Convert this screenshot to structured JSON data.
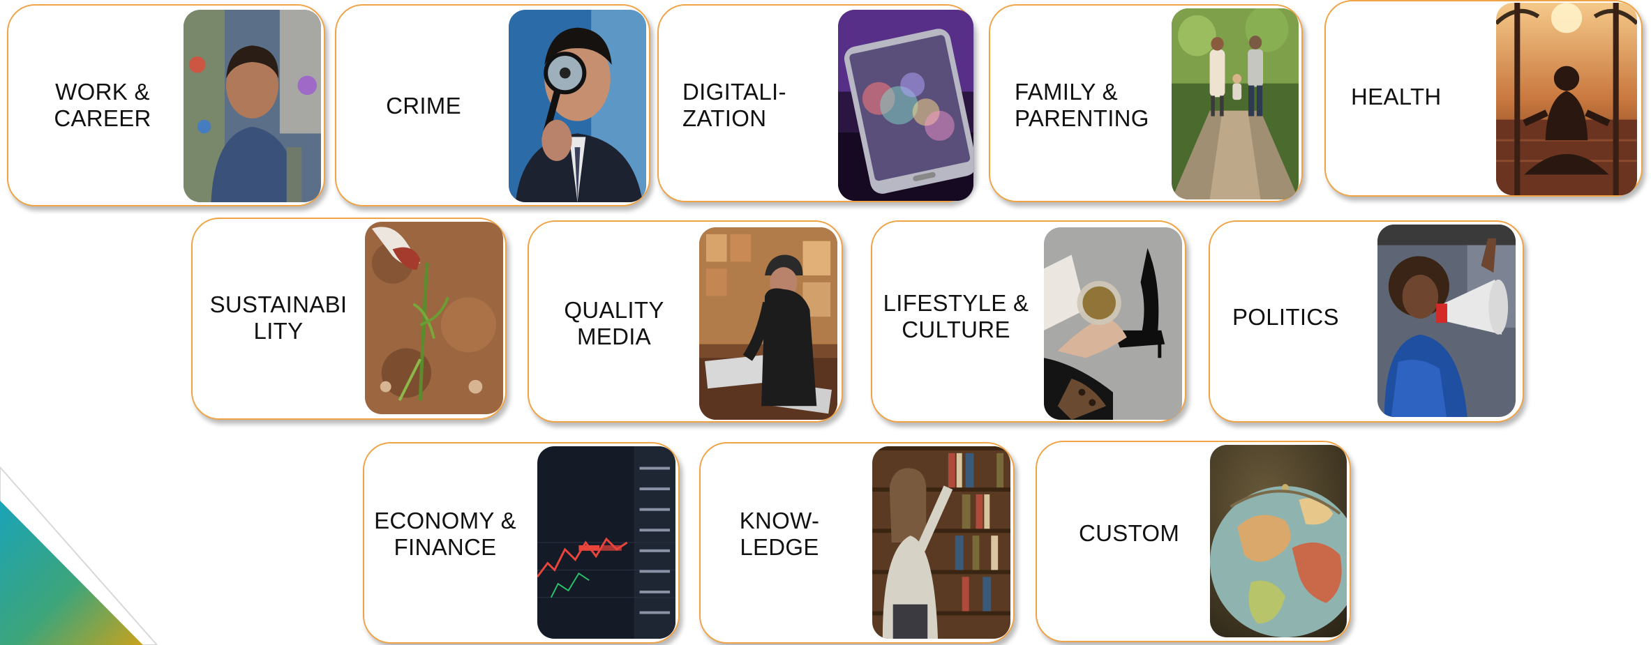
{
  "colors": {
    "card_border": "#f0a345",
    "text": "#111111",
    "background": "#ffffff"
  },
  "cards": [
    {
      "id": "work-career",
      "label": "WORK &\nCAREER",
      "photo": "man-backpack-photo"
    },
    {
      "id": "crime",
      "label": "CRIME",
      "photo": "magnifying-glass-photo"
    },
    {
      "id": "digitalization",
      "label": "DIGITALI-\nZATION",
      "photo": "smartphone-bokeh-photo"
    },
    {
      "id": "family-parenting",
      "label": "FAMILY &\nPARENTING",
      "photo": "family-walking-path-photo"
    },
    {
      "id": "health",
      "label": "HEALTH",
      "photo": "meditation-sunset-photo"
    },
    {
      "id": "sustainability",
      "label": "SUSTAINABI\nLITY",
      "photo": "planting-seedling-photo"
    },
    {
      "id": "quality-media",
      "label": "QUALITY\nMEDIA",
      "photo": "newsstand-reader-photo"
    },
    {
      "id": "lifestyle-culture",
      "label": "LIFESTYLE &\nCULTURE",
      "photo": "high-heels-tea-photo"
    },
    {
      "id": "politics",
      "label": "POLITICS",
      "photo": "megaphone-protest-photo"
    },
    {
      "id": "economy-finance",
      "label": "ECONOMY &\nFINANCE",
      "photo": "stock-chart-screen-photo"
    },
    {
      "id": "knowledge",
      "label": "KNOW-\nLEDGE",
      "photo": "library-bookshelf-photo"
    },
    {
      "id": "custom",
      "label": "CUSTOM",
      "photo": "globe-photo"
    }
  ]
}
